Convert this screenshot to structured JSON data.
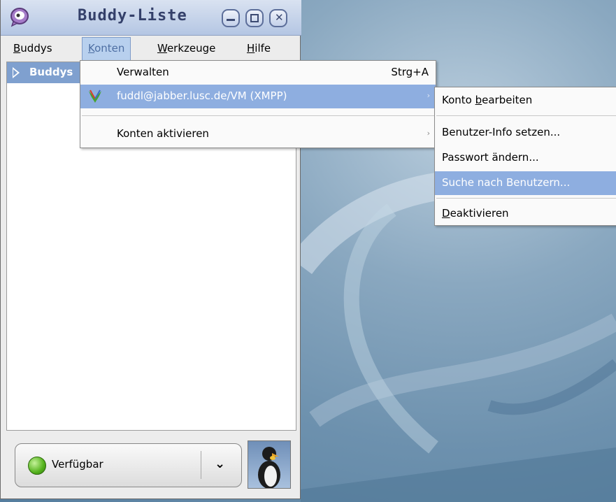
{
  "window": {
    "title": "Buddy-Liste",
    "controls": [
      "minimize-icon",
      "maximize-icon",
      "close-icon"
    ]
  },
  "menubar": {
    "items": [
      {
        "label_ul": "B",
        "label_rest": "uddys"
      },
      {
        "label_ul": "K",
        "label_rest": "onten"
      },
      {
        "label_ul": "W",
        "label_rest": "erkzeuge"
      },
      {
        "label_ul": "H",
        "label_rest": "ilfe"
      }
    ]
  },
  "buddy_tree": {
    "group_label": "Buddys"
  },
  "konten_menu": {
    "manage_label": "Verwalten",
    "manage_shortcut": "Strg+A",
    "account_label": "fuddl@jabber.lusc.de/VM (XMPP)",
    "account_icon": "xmpp-icon",
    "enable_accounts_label": "Konten aktivieren",
    "submenu_arrow": "›"
  },
  "account_submenu": {
    "edit_prefix": "Konto ",
    "edit_ul": "b",
    "edit_rest": "earbeiten",
    "set_user_info": "Benutzer-Info setzen...",
    "change_password": "Passwort ändern...",
    "search_users": "Suche nach Benutzern...",
    "deactivate_ul": "D",
    "deactivate_rest": "eaktivieren"
  },
  "status": {
    "label": "Verfügbar",
    "indicator_color": "#54b21c",
    "dropdown_icon": "chevron-down-icon",
    "avatar_icon": "penguin-icon"
  },
  "colors": {
    "highlight": "#8eaee0",
    "group_row": "#7fa0cf",
    "titlebar_text": "#34406a"
  }
}
